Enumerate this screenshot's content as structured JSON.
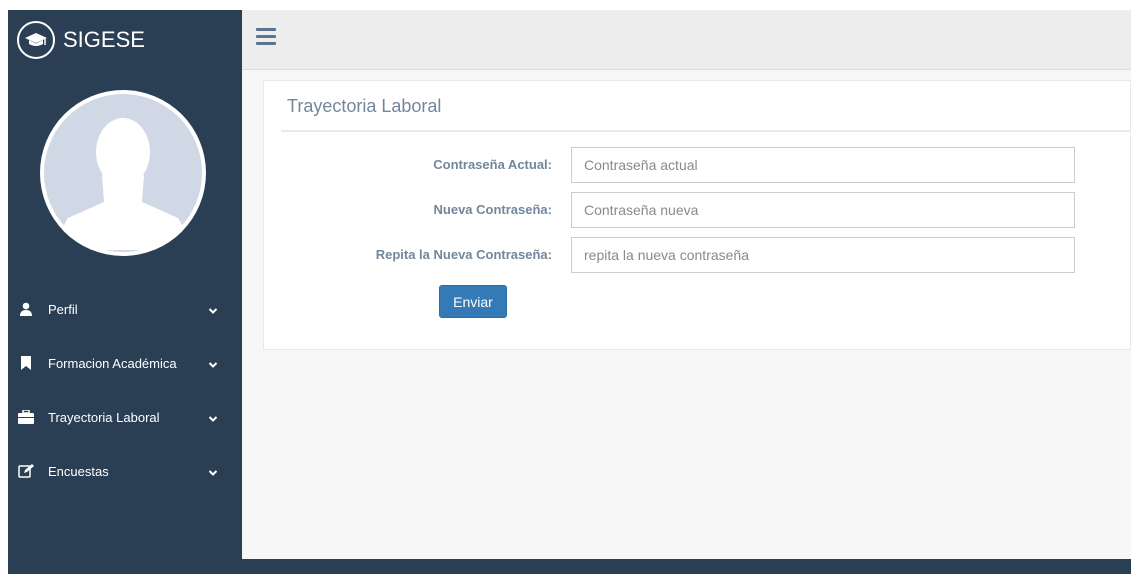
{
  "app": {
    "title": "SIGESE"
  },
  "sidebar": {
    "items": [
      {
        "label": "Perfil",
        "icon": "user-icon"
      },
      {
        "label": "Formacion Académica",
        "icon": "bookmark-icon"
      },
      {
        "label": "Trayectoria Laboral",
        "icon": "briefcase-icon"
      },
      {
        "label": "Encuestas",
        "icon": "edit-icon"
      }
    ]
  },
  "panel": {
    "title": "Trayectoria Laboral",
    "fields": [
      {
        "label": "Contraseña Actual:",
        "placeholder": "Contraseña actual"
      },
      {
        "label": "Nueva Contraseña:",
        "placeholder": "Contraseña nueva"
      },
      {
        "label": "Repita la Nueva Contraseña:",
        "placeholder": "repita la nueva contraseña"
      }
    ],
    "submit_label": "Enviar"
  },
  "colors": {
    "sidebar": "#2a3f54",
    "accent": "#337ab7",
    "label": "#73879c"
  }
}
